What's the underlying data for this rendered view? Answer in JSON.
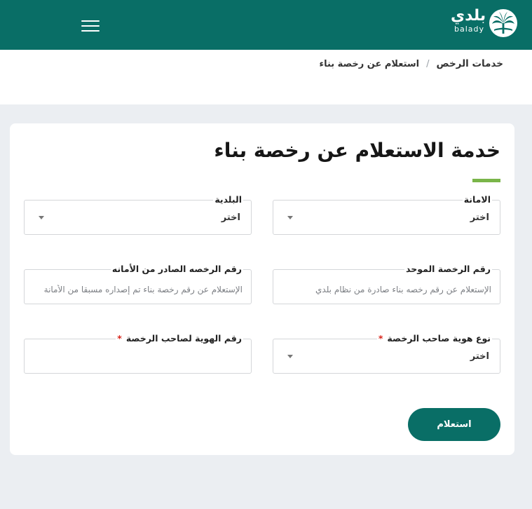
{
  "header": {
    "logo_arabic": "بلدي",
    "logo_latin": "balady",
    "menu_icon": "hamburger-menu-icon"
  },
  "breadcrumb": {
    "items": [
      "خدمات الرخص",
      "استعلام عن رخصة بناء"
    ],
    "separator": "/"
  },
  "page": {
    "title": "خدمة الاستعلام عن رخصة بناء"
  },
  "form": {
    "amanah": {
      "label": "الامانة",
      "value": "اختر"
    },
    "baladiya": {
      "label": "البلدية",
      "value": "اختر"
    },
    "unified_license_number": {
      "label": "رقم الرخصة الموحد",
      "placeholder": "الإستعلام عن رقم رخصه بناء صادرة من نظام بلدي",
      "value": ""
    },
    "amanah_license_number": {
      "label": "رقم الرخصه الصادر من الأمانه",
      "placeholder": "الإستعلام عن رقم رخصة بناء تم إصداره مسبقا من الأمانة",
      "value": ""
    },
    "owner_id_type": {
      "label": "نوع هوية صاحب الرخصة",
      "required_mark": "*",
      "value": "اختر"
    },
    "owner_id_number": {
      "label": "رقم الهوية لصاحب الرخصة",
      "required_mark": "*",
      "value": ""
    },
    "submit_label": "استعلام"
  },
  "colors": {
    "brand": "#096e66",
    "accent": "#7ab549",
    "required": "#d9261c",
    "page_background": "#ebeef2"
  }
}
